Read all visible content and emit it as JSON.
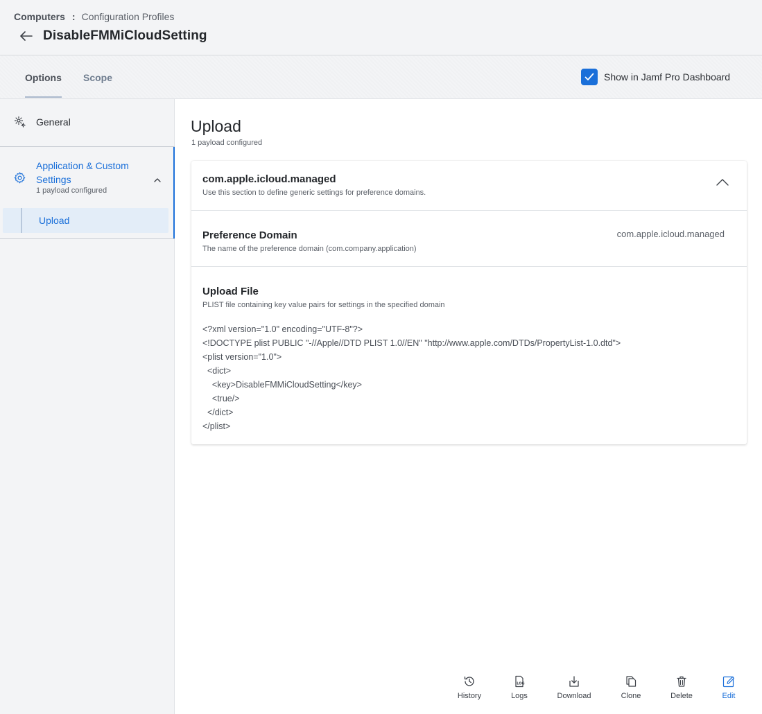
{
  "breadcrumb": {
    "root": "Computers",
    "separator": ":",
    "current": "Configuration Profiles"
  },
  "header": {
    "title": "DisableFMMiCloudSetting"
  },
  "tabs": [
    {
      "label": "Options",
      "active": true
    },
    {
      "label": "Scope",
      "active": false
    }
  ],
  "dashboard_toggle": {
    "label": "Show in Jamf Pro Dashboard",
    "checked": true
  },
  "sidebar": {
    "general_label": "General",
    "app_label": "Application & Custom Settings",
    "app_sub": "1 payload configured",
    "upload_label": "Upload"
  },
  "main": {
    "title": "Upload",
    "subtitle": "1 payload configured",
    "card": {
      "heading": "com.apple.icloud.managed",
      "description": "Use this section to define generic settings for preference domains.",
      "preference_domain": {
        "label": "Preference Domain",
        "description": "The name of the preference domain (com.company.application)",
        "value": "com.apple.icloud.managed"
      },
      "upload_file": {
        "label": "Upload File",
        "description": "PLIST file containing key value pairs for settings in the specified domain",
        "lines": [
          "<?xml version=\"1.0\" encoding=\"UTF-8\"?>",
          "<!DOCTYPE plist PUBLIC \"-//Apple//DTD PLIST 1.0//EN\" \"http://www.apple.com/DTDs/PropertyList-1.0.dtd\">",
          "<plist version=\"1.0\">",
          "  <dict>",
          "    <key>DisableFMMiCloudSetting</key>",
          "    <true/>",
          "  </dict>",
          "</plist>"
        ]
      }
    }
  },
  "actions": {
    "history": "History",
    "logs": "Logs",
    "logs_icon_text": "LOG",
    "download": "Download",
    "clone": "Clone",
    "delete": "Delete",
    "edit": "Edit"
  },
  "colors": {
    "accent": "#1a6fd9",
    "background": "#f3f4f6",
    "text": "#2b2e33"
  }
}
